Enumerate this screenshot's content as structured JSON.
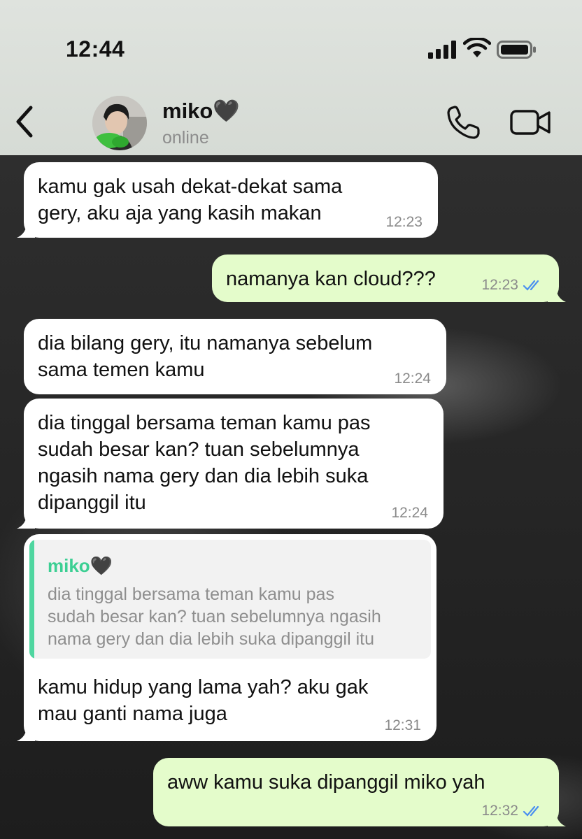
{
  "status_bar": {
    "time": "12:44"
  },
  "header": {
    "contact_name": "miko🖤",
    "contact_status": "online"
  },
  "messages": [
    {
      "direction": "in",
      "text_lines": [
        "kamu gak usah dekat-dekat sama",
        "gery, aku aja yang kasih makan"
      ],
      "time": "12:23"
    },
    {
      "direction": "out",
      "text_lines": [
        "namanya kan cloud???"
      ],
      "time": "12:23",
      "read": true
    },
    {
      "direction": "in",
      "text_lines": [
        "dia bilang gery, itu namanya sebelum",
        "sama temen kamu"
      ],
      "time": "12:24"
    },
    {
      "direction": "in",
      "text_lines": [
        "dia tinggal bersama teman kamu pas",
        "sudah besar kan? tuan sebelumnya",
        "ngasih nama gery dan dia lebih suka",
        "dipanggil itu"
      ],
      "time": "12:24"
    },
    {
      "direction": "in",
      "reply_to": {
        "name": "miko🖤",
        "text_lines": [
          "dia tinggal bersama teman kamu pas",
          "sudah besar kan? tuan sebelumnya ngasih",
          "nama gery dan dia lebih suka dipanggil itu"
        ]
      },
      "text_lines": [
        "kamu hidup yang lama yah? aku gak",
        "mau ganti nama juga"
      ],
      "time": "12:31"
    },
    {
      "direction": "out",
      "text_lines": [
        "aww kamu suka dipanggil miko yah"
      ],
      "time": "12:32",
      "read": true
    }
  ],
  "colors": {
    "incoming_bubble": "#ffffff",
    "outgoing_bubble": "#e4fccb",
    "read_ticks": "#4a8ff0",
    "quote_accent": "#4fd6a0"
  },
  "icons": [
    "back-chevron-icon",
    "phone-icon",
    "video-camera-icon",
    "signal-icon",
    "wifi-icon",
    "battery-icon",
    "double-check-icon"
  ]
}
